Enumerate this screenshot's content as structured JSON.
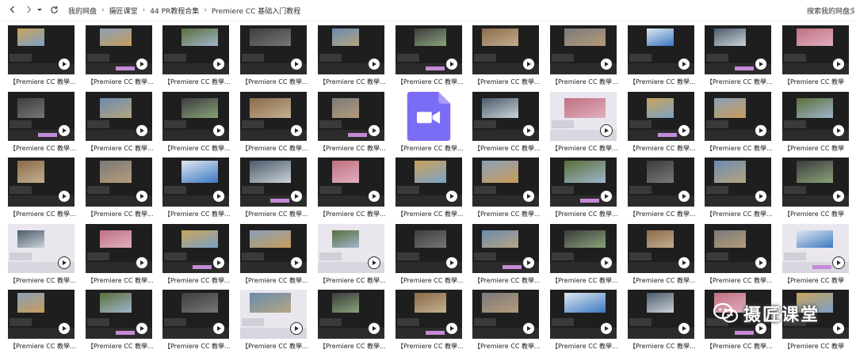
{
  "nav": {
    "back_icon": "chevron-left-icon",
    "forward_icon": "chevron-right-icon",
    "history_icon": "dropdown-icon",
    "refresh_icon": "refresh-icon"
  },
  "breadcrumb": [
    "我的网盘",
    "摄匠课堂",
    "44 PR教程合集",
    "Premiere CC 基础入门教程"
  ],
  "search": {
    "placeholder": "搜索我的网盘文"
  },
  "files": {
    "caption": "【Premiere CC 教學...",
    "caption_short": "【Premiere CC 教學",
    "rows": 5,
    "cols": 11
  },
  "watermark": {
    "text": "摄匠课堂"
  },
  "colors": {
    "accent_icon": "#7b6cf6",
    "dark_ui": "#1e1e1e"
  }
}
